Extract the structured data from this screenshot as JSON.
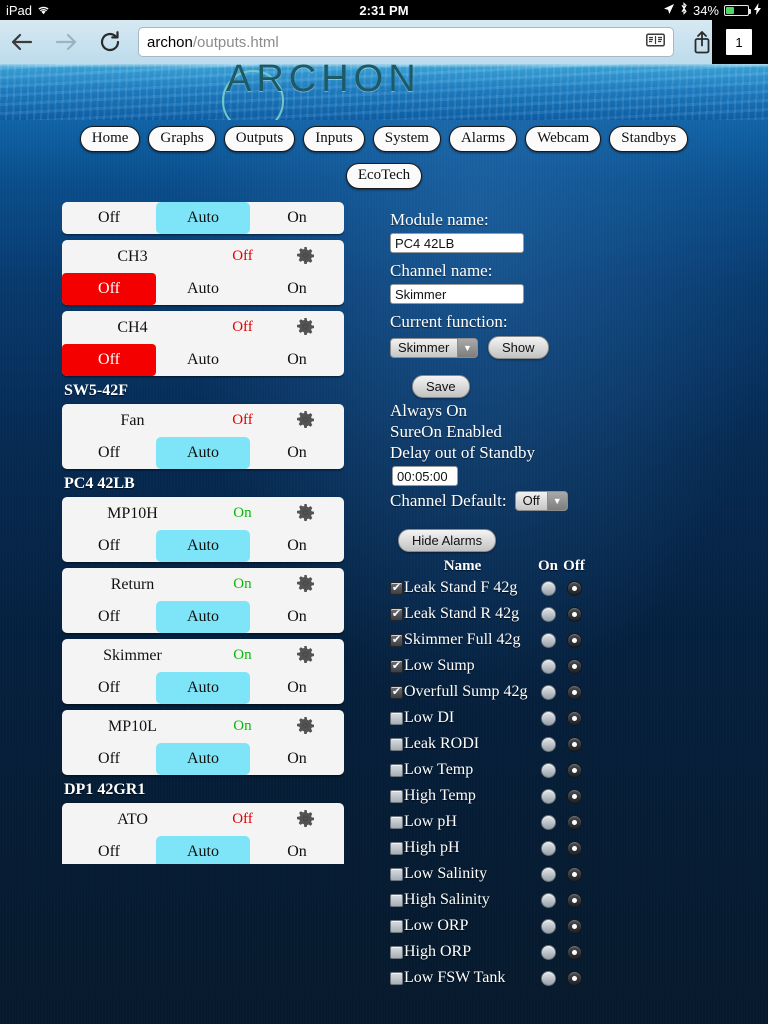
{
  "status_bar": {
    "device": "iPad",
    "wifi_icon": "wifi-icon",
    "time": "2:31 PM",
    "location_icon": "location-arrow-icon",
    "bluetooth_icon": "bluetooth-icon",
    "battery_percent": "34%",
    "battery_level": 34,
    "charging_icon": "lightning-bolt-icon"
  },
  "browser": {
    "back_icon": "back-arrow-icon",
    "forward_icon": "forward-arrow-icon",
    "reload_icon": "reload-icon",
    "url_host": "archon",
    "url_path": "/outputs.html",
    "reader_icon": "reader-view-icon",
    "share_icon": "share-icon",
    "bookmark_icon": "bookmark-star-icon",
    "tab_count": "1"
  },
  "banner": {
    "logo_text": "ARCHON"
  },
  "nav": {
    "primary": [
      {
        "label": "Home"
      },
      {
        "label": "Graphs"
      },
      {
        "label": "Outputs"
      },
      {
        "label": "Inputs"
      },
      {
        "label": "System"
      },
      {
        "label": "Alarms"
      },
      {
        "label": "Webcam"
      },
      {
        "label": "Standbys"
      }
    ],
    "secondary": [
      {
        "label": "EcoTech"
      }
    ]
  },
  "channel_buttons": {
    "off": "Off",
    "auto": "Auto",
    "on": "On"
  },
  "channels": [
    {
      "partial_top": true,
      "name": "",
      "state": "",
      "state_kind": "",
      "selected": "auto"
    },
    {
      "name": "CH3",
      "state": "Off",
      "state_kind": "off",
      "selected": "off"
    },
    {
      "name": "CH4",
      "state": "Off",
      "state_kind": "off",
      "selected": "off"
    },
    {
      "group": "SW5-42F"
    },
    {
      "name": "Fan",
      "state": "Off",
      "state_kind": "off",
      "selected": "auto"
    },
    {
      "group": "PC4 42LB"
    },
    {
      "name": "MP10H",
      "state": "On",
      "state_kind": "on",
      "selected": "auto"
    },
    {
      "name": "Return",
      "state": "On",
      "state_kind": "on",
      "selected": "auto"
    },
    {
      "name": "Skimmer",
      "state": "On",
      "state_kind": "on",
      "selected": "auto"
    },
    {
      "name": "MP10L",
      "state": "On",
      "state_kind": "on",
      "selected": "auto"
    },
    {
      "group": "DP1 42GR1"
    },
    {
      "name": "ATO",
      "state": "Off",
      "state_kind": "off",
      "selected": "auto"
    }
  ],
  "form": {
    "module_name_label": "Module name:",
    "module_name_value": "PC4 42LB",
    "channel_name_label": "Channel name:",
    "channel_name_value": "Skimmer",
    "current_function_label": "Current function:",
    "current_function_value": "Skimmer",
    "show_button": "Show",
    "save_button": "Save",
    "always_on_text": "Always On",
    "sureon_text": "SureOn Enabled",
    "delay_label": "Delay out of Standby",
    "delay_value": "00:05:00",
    "channel_default_label": "Channel Default:",
    "channel_default_value": "Off",
    "hide_alarms_button": "Hide Alarms"
  },
  "alarms": {
    "header": {
      "name": "Name",
      "on": "On",
      "off": "Off"
    },
    "rows": [
      {
        "name": "Leak Stand F 42g",
        "checked": true,
        "radio": "off"
      },
      {
        "name": "Leak Stand R 42g",
        "checked": true,
        "radio": "off"
      },
      {
        "name": "Skimmer Full 42g",
        "checked": true,
        "radio": "off"
      },
      {
        "name": "Low Sump",
        "checked": true,
        "radio": "off"
      },
      {
        "name": "Overfull Sump 42g",
        "checked": true,
        "radio": "off"
      },
      {
        "name": "Low DI",
        "checked": false,
        "radio": "off"
      },
      {
        "name": "Leak RODI",
        "checked": false,
        "radio": "off"
      },
      {
        "name": "Low Temp",
        "checked": false,
        "radio": "off"
      },
      {
        "name": "High Temp",
        "checked": false,
        "radio": "off"
      },
      {
        "name": "Low pH",
        "checked": false,
        "radio": "off"
      },
      {
        "name": "High pH",
        "checked": false,
        "radio": "off"
      },
      {
        "name": "Low Salinity",
        "checked": false,
        "radio": "off"
      },
      {
        "name": "High Salinity",
        "checked": false,
        "radio": "off"
      },
      {
        "name": "Low ORP",
        "checked": false,
        "radio": "off"
      },
      {
        "name": "High ORP",
        "checked": false,
        "radio": "off"
      },
      {
        "name": "Low FSW Tank",
        "checked": false,
        "radio": "off"
      }
    ]
  },
  "colors": {
    "auto_selected": "#7ee4f7",
    "off_selected": "#f50000",
    "state_on": "#0ab60a",
    "state_off": "#e00000",
    "battery_green": "#4cd964"
  }
}
